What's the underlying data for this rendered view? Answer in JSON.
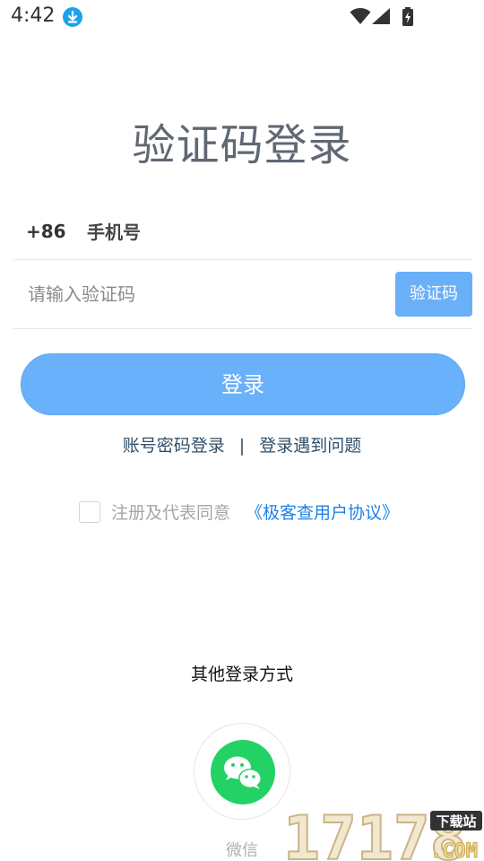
{
  "status_bar": {
    "time": "4:42",
    "icons": [
      "download-icon",
      "wifi-icon",
      "signal-icon",
      "battery-icon"
    ]
  },
  "login": {
    "title": "验证码登录",
    "country_code": "+86",
    "phone_placeholder": "手机号",
    "code_placeholder": "请输入验证码",
    "get_code_label": "验证码",
    "submit_label": "登录"
  },
  "links": {
    "account_password": "账号密码登录",
    "separator": "|",
    "problem": "登录遇到问题"
  },
  "agreement": {
    "checked": false,
    "text": "注册及代表同意",
    "link": "《极客查用户协议》"
  },
  "other_login": {
    "heading": "其他登录方式",
    "wechat_label": "微信"
  },
  "watermark": {
    "digits": "17178",
    "tag": "下载站",
    "domain": ".COM"
  },
  "colors": {
    "accent": "#69b1fa",
    "link": "#1e82e6",
    "wechat": "#22d265",
    "download_badge": "#1aa3e8"
  }
}
